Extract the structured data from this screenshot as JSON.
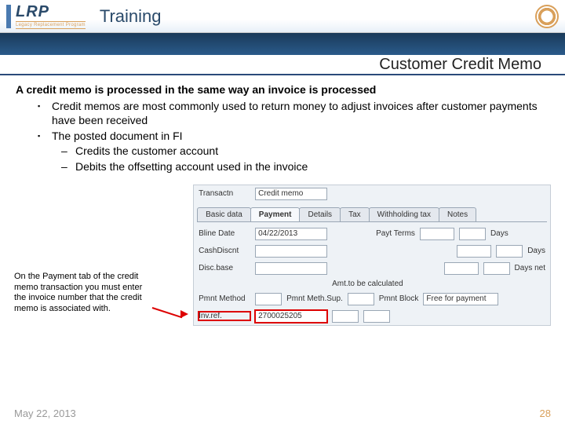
{
  "header": {
    "logo_main": "LRP",
    "logo_sub": "Legacy Replacement Program",
    "title": "Training"
  },
  "subbanner": {
    "title": "Customer Credit Memo"
  },
  "content": {
    "lead": "A credit memo is processed in the same way an invoice is processed",
    "b1": "Credit memos are most commonly used to return money to adjust invoices after customer payments have been received",
    "b2": "The posted document  in FI",
    "d1": "Credits the customer account",
    "d2": "Debits the offsetting account used in the invoice"
  },
  "caption": "On the Payment tab of the credit memo transaction you must enter the invoice number that the credit memo is associated with.",
  "sap": {
    "trans_lbl": "Transactn",
    "trans_val": "Credit memo",
    "tabs": {
      "basic": "Basic data",
      "payment": "Payment",
      "details": "Details",
      "tax": "Tax",
      "withholding": "Withholding tax",
      "notes": "Notes"
    },
    "bline_lbl": "Bline Date",
    "bline_val": "04/22/2013",
    "payt_lbl": "Payt Terms",
    "days_lbl": "Days",
    "cashd_lbl": "CashDiscnt",
    "discbase_lbl": "Disc.base",
    "daysnet_lbl": "Days net",
    "amt_lbl": "Amt.to be calculated",
    "pmnt_lbl": "Pmnt Method",
    "pmsup_lbl": "Pmnt Meth.Sup.",
    "pblock_lbl": "Pmnt Block",
    "pblock_val": "Free for payment",
    "invref_lbl": "Inv.ref.",
    "invref_val": "2700025205"
  },
  "footer": {
    "date": "May 22, 2013",
    "page": "28"
  }
}
